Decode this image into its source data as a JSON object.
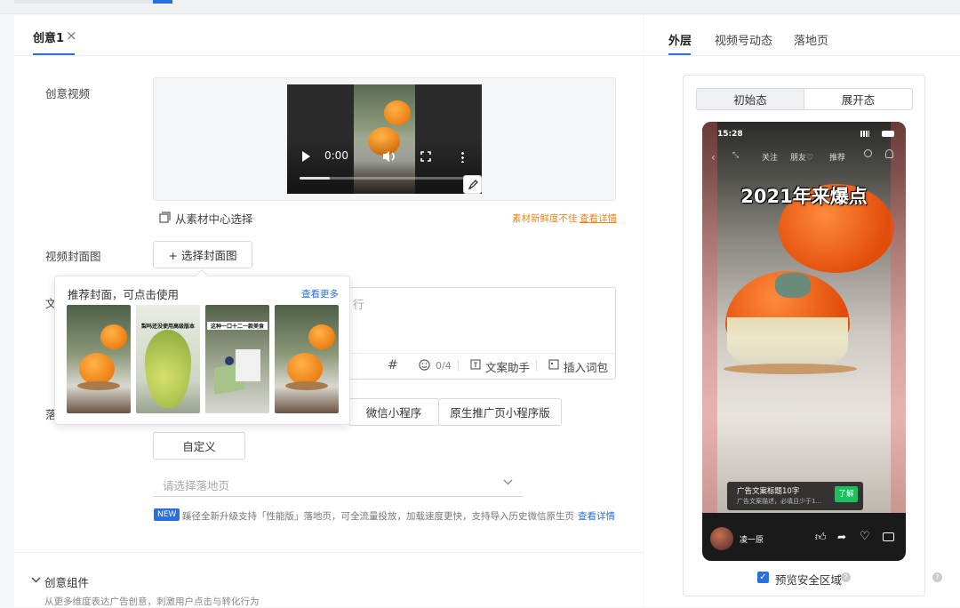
{
  "tabs_left": {
    "active": "创意1",
    "close": "×"
  },
  "tabs_right": [
    "外层",
    "视频号动态",
    "落地页"
  ],
  "video": {
    "time": "0:00"
  },
  "material_select": "从素材中心选择",
  "freshness": {
    "text": "素材新鲜度不佳",
    "link": "查看详情"
  },
  "labels": {
    "creative_video": "创意视频",
    "cover": "视频封面图",
    "copy_partial": "文",
    "landing_partial": "落"
  },
  "cover_button": "+ 选择封面图",
  "popover": {
    "title": "推荐封面，可点击使用",
    "more": "查看更多",
    "thumb_texts": [
      "",
      "梨吗还没使用高级版本",
      "这种一口十二一款美食",
      ""
    ]
  },
  "copy": {
    "placeholder_partial": "行",
    "count": "0/4",
    "assistant": "文案助手",
    "insert": "插入词包"
  },
  "landing_options": [
    "微信小程序",
    "原生推广页小程序版",
    "自定义"
  ],
  "landing_select_placeholder": "请选择落地页",
  "notice": {
    "badge": "NEW",
    "text": "蹊径全新升级支持「性能版」落地页，可全流量投放，加载速度更快，支持导入历史微信原生页",
    "link": "查看详情"
  },
  "component": {
    "title": "创意组件",
    "desc": "从更多维度表达广告创意，刺激用户点击与转化行为"
  },
  "preview_states": [
    "初始态",
    "展开态"
  ],
  "phone": {
    "time": "15:28",
    "nav": [
      "关注",
      "朋友♡",
      "推荐"
    ],
    "headline": "2021年来爆点",
    "ad_title": "广告文案标题10字",
    "ad_desc": "广告文案描述，必填且少于1...",
    "ad_button": "了解",
    "user": "凌一原"
  },
  "safe_area": "预览安全区域",
  "colors": {
    "accent": "#2a6fe0",
    "orange": "#f2820f",
    "green": "#1dbf5f"
  }
}
